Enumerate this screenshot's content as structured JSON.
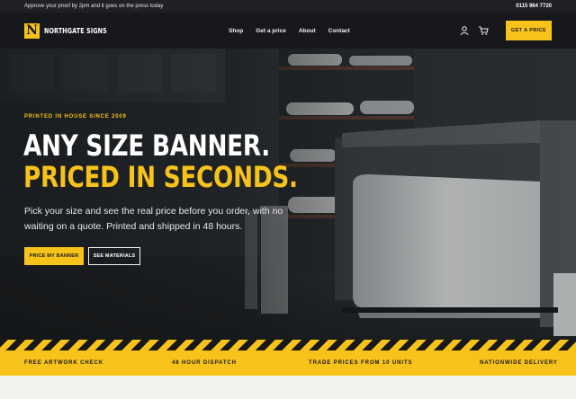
{
  "topbar": {
    "promo": "Approve your proof by 2pm and it goes on the press today",
    "phone": "0115 964 7720"
  },
  "nav": {
    "logo_mark": "N",
    "brand": "NORTHGATE SIGNS",
    "links": [
      "Shop",
      "Get a price",
      "About",
      "Contact"
    ],
    "account_icon": "user-icon",
    "cart_icon": "cart-icon",
    "cta": "GET A PRICE"
  },
  "hero": {
    "eyebrow": "PRINTED IN HOUSE SINCE 2009",
    "headline_line1": "ANY SIZE BANNER.",
    "headline_line2": "PRICED IN SECONDS.",
    "lede": "Pick your size and see the real price before you order, with no waiting on a quote. Printed and shipped in 48 hours.",
    "primary_cta": "PRICE MY BANNER",
    "secondary_cta": "SEE MATERIALS"
  },
  "features": [
    "FREE ARTWORK CHECK",
    "48 HOUR DISPATCH",
    "TRADE PRICES FROM 10 UNITS",
    "NATIONWIDE DELIVERY"
  ],
  "colors": {
    "accent": "#f7c21a",
    "dark": "#16181b",
    "topbar": "#1e2023"
  }
}
